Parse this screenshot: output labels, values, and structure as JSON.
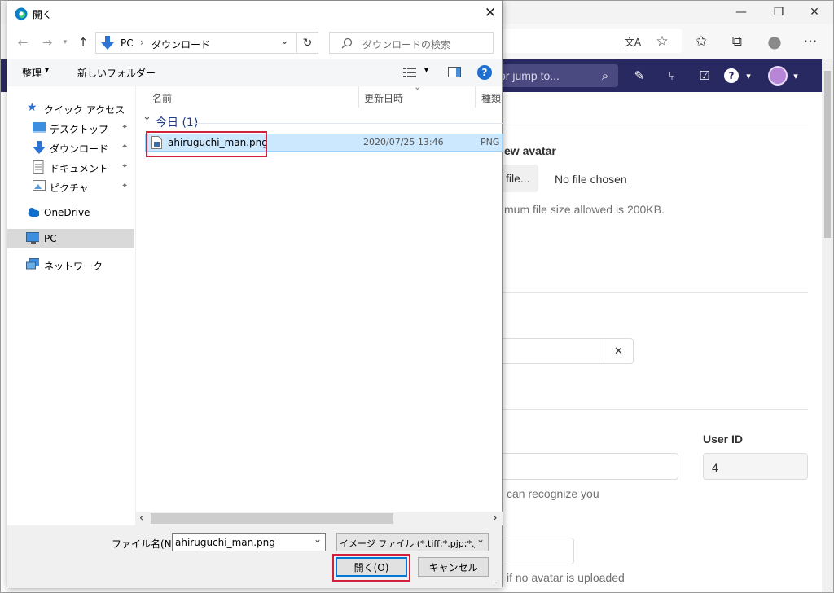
{
  "browser": {
    "minimize": "—",
    "restore": "❐",
    "close": "✕",
    "toolbar_icons": {
      "translate": "文A",
      "favorite": "☆",
      "favorites_list": "✩",
      "collections": "⧉",
      "profile": "●",
      "more": "⋯"
    }
  },
  "gitlab": {
    "search_placeholder": "or jump to...",
    "nav_icons": {
      "search": "⌕",
      "issues_new": "✎",
      "merge_requests": "⑂",
      "todos": "☑",
      "help": "?",
      "help_caret": "▾",
      "avatar_caret": "▾"
    },
    "new_avatar_label": "ew avatar",
    "choose_file_button": "file...",
    "no_file_chosen": "No file chosen",
    "max_size_hint": "mum file size allowed is 200KB.",
    "clear_icon": "✕",
    "user_id_label": "User ID",
    "user_id_value": "4",
    "recognize_hint": "can recognize you",
    "avatar_fallback_hint": "if no avatar is uploaded"
  },
  "dialog": {
    "title": "開く",
    "close": "✕",
    "nav": {
      "back": "←",
      "forward": "→",
      "recent": "▾",
      "up": "↑"
    },
    "breadcrumb": {
      "root": "PC",
      "separator": "›",
      "current": "ダウンロード",
      "dropdown": "⌄"
    },
    "refresh": "↻",
    "search_placeholder": "ダウンロードの検索",
    "command_bar": {
      "organize": "整理",
      "organize_caret": "▾",
      "new_folder": "新しいフォルダー",
      "view_caret": "▾",
      "help": "?"
    },
    "nav_pane": {
      "quick_access": "クイック アクセス",
      "desktop": "デスクトップ",
      "downloads": "ダウンロード",
      "documents": "ドキュメント",
      "pictures": "ピクチャ",
      "onedrive": "OneDrive",
      "pc": "PC",
      "network": "ネットワーク",
      "pin": "📌"
    },
    "columns": {
      "name": "名前",
      "date_modified": "更新日時",
      "type": "種類",
      "sort_caret": "⌄"
    },
    "group": {
      "label": "今日",
      "count": "(1)",
      "caret": "⌄"
    },
    "file": {
      "name": "ahiruguchi_man.png",
      "date": "2020/07/25 13:46",
      "type": "PNG"
    },
    "scroll": {
      "left": "‹",
      "right": "›"
    },
    "filename_label": "ファイル名(N):",
    "filename_value": "ahiruguchi_man.png",
    "filename_caret": "⌄",
    "filetype_value": "イメージ ファイル (*.tiff;*.pjp;*.jfif;*.",
    "filetype_caret": "⌄",
    "open_button": "開く(O)",
    "cancel_button": "キャンセル"
  }
}
